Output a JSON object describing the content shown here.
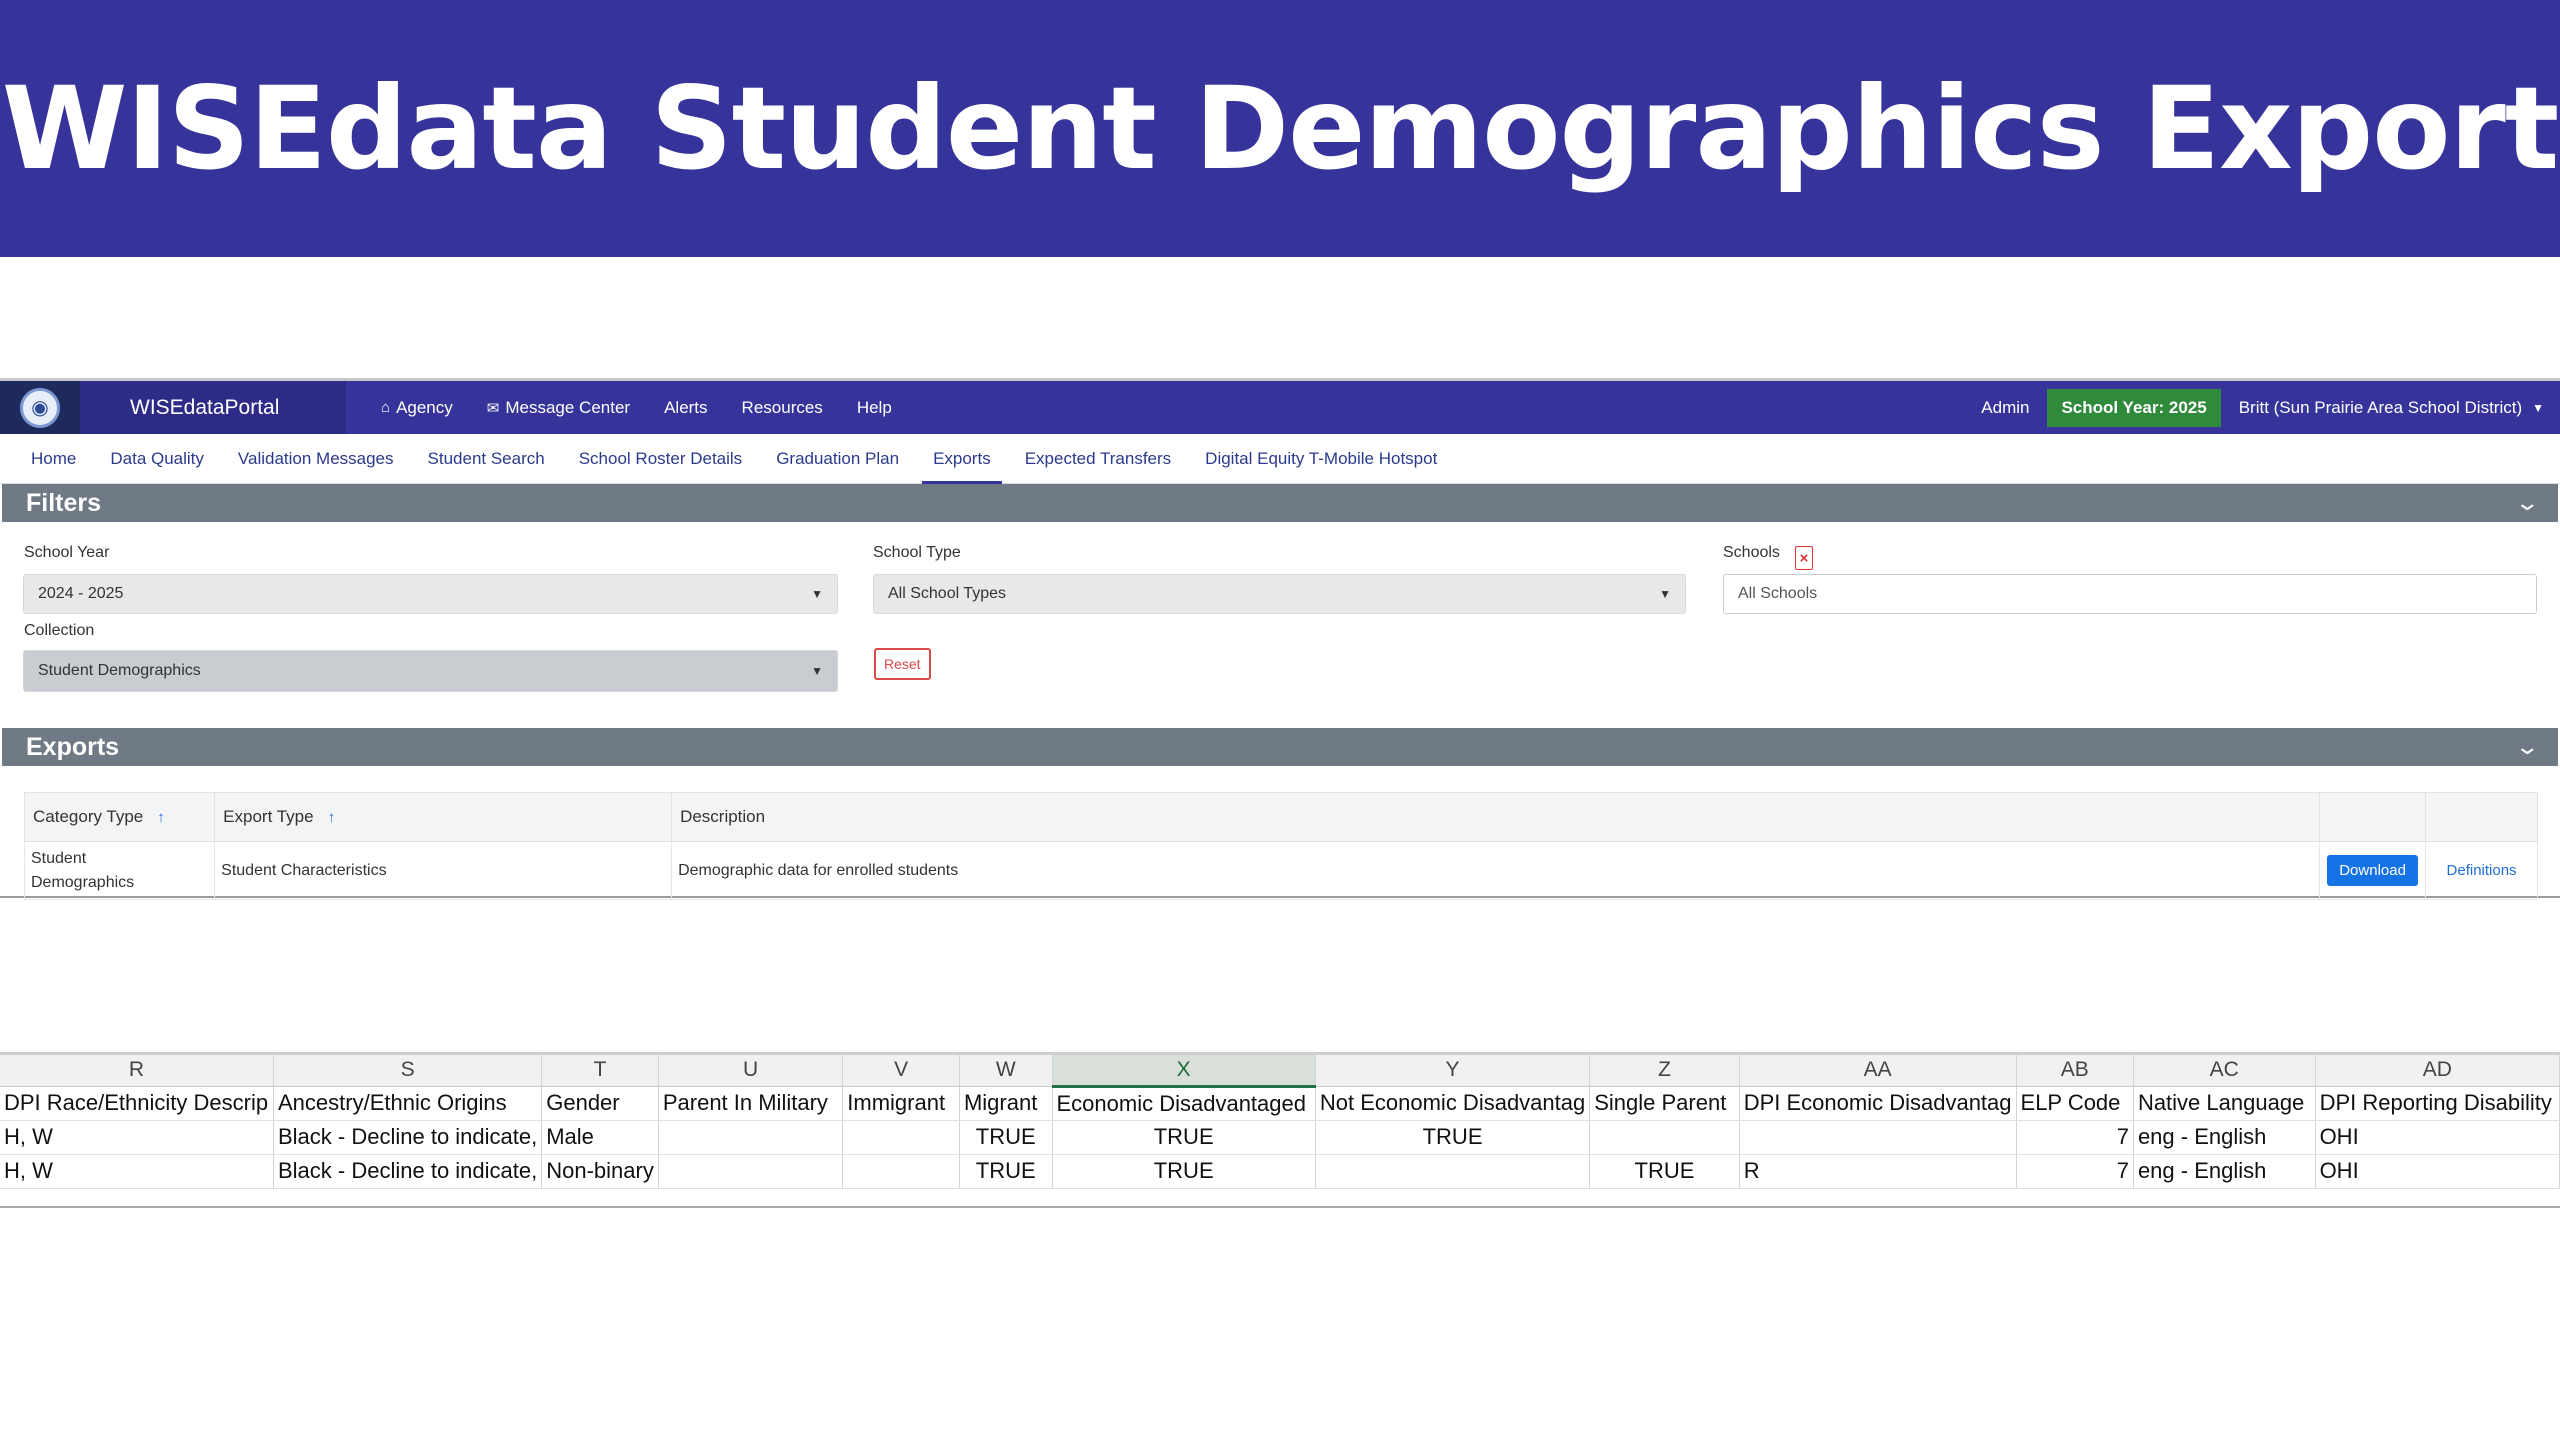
{
  "banner": {
    "title": "WISEdata Student Demographics Export"
  },
  "portal": {
    "name": "WISEdataPortal",
    "nav": [
      {
        "label": "Agency",
        "icon": "home-icon"
      },
      {
        "label": "Message Center",
        "icon": "envelope-icon"
      },
      {
        "label": "Alerts"
      },
      {
        "label": "Resources"
      },
      {
        "label": "Help"
      }
    ],
    "admin": "Admin",
    "school_year_badge": "School Year: 2025",
    "user": "Britt (Sun Prairie Area School District)",
    "subnav": [
      "Home",
      "Data Quality",
      "Validation Messages",
      "Student Search",
      "School Roster Details",
      "Graduation Plan",
      "Exports",
      "Expected Transfers",
      "Digital Equity T-Mobile Hotspot"
    ],
    "active_subnav": "Exports"
  },
  "filters": {
    "title": "Filters",
    "school_year_label": "School Year",
    "school_year_value": "2024 - 2025",
    "school_type_label": "School Type",
    "school_type_value": "All School Types",
    "schools_label": "Schools",
    "schools_placeholder": "All Schools",
    "collection_label": "Collection",
    "collection_value": "Student Demographics",
    "reset_label": "Reset"
  },
  "exports": {
    "title": "Exports",
    "headers": {
      "category": "Category Type",
      "export_type": "Export Type",
      "description": "Description"
    },
    "rows": [
      {
        "category": "Student Demographics",
        "export_type": "Student Characteristics",
        "description": "Demographic data for enrolled students",
        "download": "Download",
        "definitions": "Definitions"
      }
    ]
  },
  "sheet": {
    "columns": [
      "R",
      "S",
      "T",
      "U",
      "V",
      "W",
      "X",
      "Y",
      "Z",
      "AA",
      "AB",
      "AC",
      "AD"
    ],
    "selected_column": "X",
    "headers": [
      "DPI Race/Ethnicity Descrip",
      "Ancestry/Ethnic Origins",
      "Gender",
      "Parent In Military",
      "Immigrant",
      "Migrant",
      "Economic Disadvantaged",
      "Not Economic Disadvantag",
      "Single Parent",
      "DPI Economic Disadvantag",
      "ELP Code",
      "Native Language",
      "DPI Reporting Disability"
    ],
    "rows": [
      [
        "H, W",
        "Black - Decline to indicate,",
        "Male",
        "",
        "",
        "TRUE",
        "TRUE",
        "TRUE",
        "",
        "",
        "7",
        "eng - English",
        "OHI"
      ],
      [
        "H, W",
        "Black - Decline to indicate,",
        "Non-binary",
        "",
        "",
        "TRUE",
        "TRUE",
        "",
        "TRUE",
        "R",
        "7",
        "eng - English",
        "OHI"
      ]
    ]
  }
}
